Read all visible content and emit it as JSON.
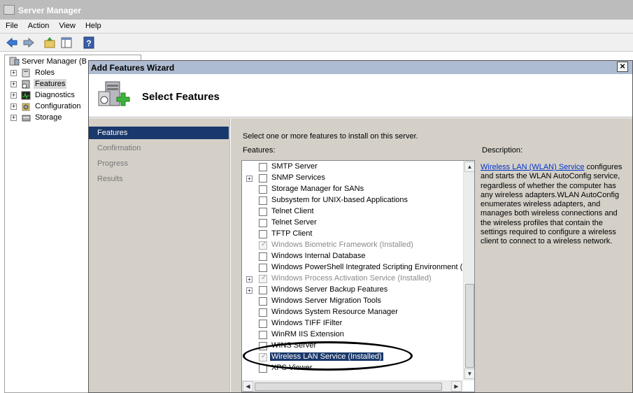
{
  "window": {
    "title": "Server Manager"
  },
  "menu": [
    "File",
    "Action",
    "View",
    "Help"
  ],
  "tree": {
    "root": "Server Manager (B",
    "items": [
      "Roles",
      "Features",
      "Diagnostics",
      "Configuration",
      "Storage"
    ]
  },
  "dialog": {
    "title": "Add Features Wizard",
    "close": "×",
    "banner_title": "Select Features",
    "steps": [
      "Features",
      "Confirmation",
      "Progress",
      "Results"
    ],
    "instruction": "Select one or more features to install on this server.",
    "features_label": "Features:",
    "description_label": "Description:",
    "description_link": "Wireless LAN (WLAN) Service",
    "description_text": "configures and starts the WLAN AutoConfig service, regardless of whether the computer has any wireless adapters.WLAN AutoConfig enumerates wireless adapters, and manages both wireless connections and the wireless profiles that contain the settings required to configure a wireless client to connect to a wireless network."
  },
  "features": [
    {
      "label": "SMTP Server",
      "expand": false,
      "checked": false,
      "installed": false,
      "selected": false
    },
    {
      "label": "SNMP Services",
      "expand": true,
      "checked": false,
      "installed": false,
      "selected": false
    },
    {
      "label": "Storage Manager for SANs",
      "expand": false,
      "checked": false,
      "installed": false,
      "selected": false
    },
    {
      "label": "Subsystem for UNIX-based Applications",
      "expand": false,
      "checked": false,
      "installed": false,
      "selected": false
    },
    {
      "label": "Telnet Client",
      "expand": false,
      "checked": false,
      "installed": false,
      "selected": false
    },
    {
      "label": "Telnet Server",
      "expand": false,
      "checked": false,
      "installed": false,
      "selected": false
    },
    {
      "label": "TFTP Client",
      "expand": false,
      "checked": false,
      "installed": false,
      "selected": false
    },
    {
      "label": "Windows Biometric Framework  (Installed)",
      "expand": false,
      "checked": true,
      "installed": true,
      "selected": false
    },
    {
      "label": "Windows Internal Database",
      "expand": false,
      "checked": false,
      "installed": false,
      "selected": false
    },
    {
      "label": "Windows PowerShell Integrated Scripting Environment (IS",
      "expand": false,
      "checked": false,
      "installed": false,
      "selected": false
    },
    {
      "label": "Windows Process Activation Service  (Installed)",
      "expand": true,
      "checked": true,
      "installed": true,
      "selected": false
    },
    {
      "label": "Windows Server Backup Features",
      "expand": true,
      "checked": false,
      "installed": false,
      "selected": false
    },
    {
      "label": "Windows Server Migration Tools",
      "expand": false,
      "checked": false,
      "installed": false,
      "selected": false
    },
    {
      "label": "Windows System Resource Manager",
      "expand": false,
      "checked": false,
      "installed": false,
      "selected": false
    },
    {
      "label": "Windows TIFF IFilter",
      "expand": false,
      "checked": false,
      "installed": false,
      "selected": false
    },
    {
      "label": "WinRM IIS Extension",
      "expand": false,
      "checked": false,
      "installed": false,
      "selected": false
    },
    {
      "label": "WINS Server",
      "expand": false,
      "checked": false,
      "installed": false,
      "selected": false
    },
    {
      "label": "Wireless LAN Service  (Installed)",
      "expand": false,
      "checked": true,
      "installed": true,
      "selected": true
    },
    {
      "label": "XPS Viewer",
      "expand": false,
      "checked": false,
      "installed": false,
      "selected": false
    }
  ],
  "colors": {
    "selection": "#19386b",
    "link": "#0033cc",
    "panel": "#d4d0c8"
  }
}
